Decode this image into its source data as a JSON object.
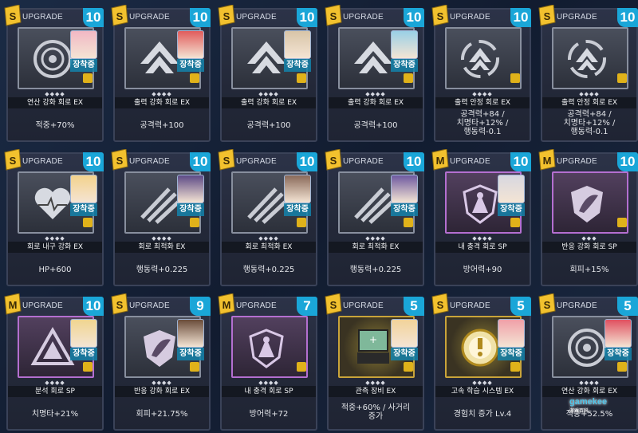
{
  "labels": {
    "upgrade": "UPGRADE",
    "equipped": "장착중",
    "stars": "◆◆◆◆",
    "stars3": "◆◆◆"
  },
  "colors": {
    "level_badge": "#1aa6d8",
    "equipped_badge": "#1482aa",
    "lock": "#e0b21a",
    "sp_frame": "#b46fd0",
    "gold_frame": "#c9a43a"
  },
  "cards": [
    {
      "level": "10",
      "name": "연산 강화 회로 EX",
      "stat": "적중+70%",
      "icon": "target-circle-icon",
      "grade": "s"
    },
    {
      "level": "10",
      "name": "출력 강화 회로 EX",
      "stat": "공격력+100",
      "icon": "chevron-up-icon",
      "grade": "s"
    },
    {
      "level": "10",
      "name": "출력 강화 회로 EX",
      "stat": "공격력+100",
      "icon": "chevron-up-icon",
      "grade": "s"
    },
    {
      "level": "10",
      "name": "출력 강화 회로 EX",
      "stat": "공격력+100",
      "icon": "chevron-up-icon",
      "grade": "s"
    },
    {
      "level": "10",
      "name": "출력 안정 회로 EX",
      "stat": "공격력+84 /\n치명타+12% /\n행동력-0.1",
      "icon": "recycle-chevron-icon",
      "grade": "s"
    },
    {
      "level": "10",
      "name": "출력 안정 회로 EX",
      "stat": "공격력+84 /\n치명타+12% /\n행동력-0.1",
      "icon": "recycle-chevron-icon",
      "grade": "s"
    },
    {
      "level": "10",
      "name": "회로 내구 강화 EX",
      "stat": "HP+600",
      "icon": "heart-icon",
      "grade": "s"
    },
    {
      "level": "10",
      "name": "회로 최적화 EX",
      "stat": "행동력+0.225",
      "icon": "claw-icon",
      "grade": "s"
    },
    {
      "level": "10",
      "name": "회로 최적화 EX",
      "stat": "행동력+0.225",
      "icon": "claw-icon",
      "grade": "s"
    },
    {
      "level": "10",
      "name": "회로 최적화 EX",
      "stat": "행동력+0.225",
      "icon": "claw-icon",
      "grade": "s"
    },
    {
      "level": "10",
      "name": "내 충격 회로 SP",
      "stat": "방어력+90",
      "icon": "shield-tower-icon",
      "grade": "m"
    },
    {
      "level": "10",
      "name": "반응 강화 회로 SP",
      "stat": "회피+15%",
      "icon": "leaf-shield-icon",
      "grade": "m"
    },
    {
      "level": "10",
      "name": "분석 회로 SP",
      "stat": "치명타+21%",
      "icon": "triangle-eye-icon",
      "grade": "m"
    },
    {
      "level": "9",
      "name": "반응 강화 회로 EX",
      "stat": "회피+21.75%",
      "icon": "leaf-shield-icon",
      "grade": "s"
    },
    {
      "level": "7",
      "name": "내 충격 회로 SP",
      "stat": "방어력+72",
      "icon": "shield-tower-icon",
      "grade": "m"
    },
    {
      "level": "5",
      "name": "관측 장비 EX",
      "stat": "적중+60% / 사거리\n증가",
      "icon": "monitor-device-icon",
      "grade": "s"
    },
    {
      "level": "5",
      "name": "고속 학습 시스템 EX",
      "stat": "경험치 증가 Lv.4",
      "icon": "gear-alert-icon",
      "grade": "s"
    },
    {
      "level": "5",
      "name": "연산 강화 회로 EX",
      "stat": "적중+52.5%",
      "icon": "target-circle-icon",
      "grade": "s"
    }
  ],
  "watermark": {
    "brand": "gamekee",
    "sub": "游戏百科"
  }
}
